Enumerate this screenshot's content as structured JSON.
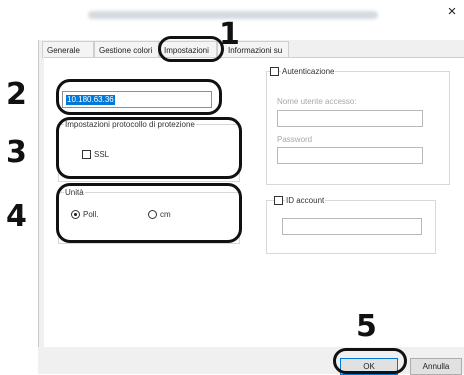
{
  "window": {
    "close_glyph": "×"
  },
  "tabs": [
    {
      "label": "Generale"
    },
    {
      "label": "Gestione colori"
    },
    {
      "label": "Impostazioni"
    },
    {
      "label": "Informazioni su"
    }
  ],
  "address_field": {
    "value": "10.180.63.36"
  },
  "protocol_group": {
    "title": "Impostazioni protocollo di protezione",
    "ssl_label": "SSL"
  },
  "units_group": {
    "title": "Unità",
    "options": [
      {
        "label": "Poll.",
        "selected": true
      },
      {
        "label": "cm",
        "selected": false
      }
    ]
  },
  "auth_group": {
    "title": "Autenticazione",
    "username_label": "Nome utente accesso:",
    "password_label": "Password"
  },
  "id_account": {
    "title": "ID account"
  },
  "buttons": {
    "ok": "OK",
    "cancel": "Annulla"
  },
  "callouts": [
    "1",
    "2",
    "3",
    "4",
    "5"
  ]
}
